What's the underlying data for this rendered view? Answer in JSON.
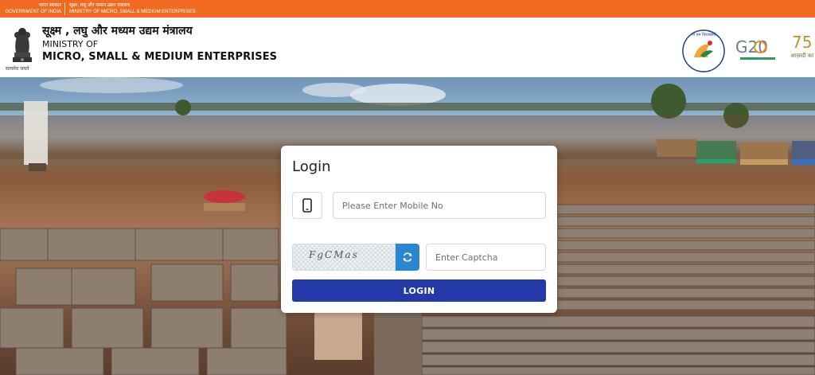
{
  "gov_strip": {
    "hindi_gov": "भारत सरकार",
    "english_gov": "GOVERNMENT OF INDIA",
    "hindi_ministry": "सूक्ष्म, लघु और मध्यम उद्यम मंत्रालय",
    "english_ministry": "MINISTRY OF MICRO, SMALL & MEDIUM ENTERPRISES"
  },
  "header": {
    "emblem_caption": "सत्यमेव जयते",
    "ministry_hindi": "सूक्ष्म , लघु और मध्यम उद्यम मंत्रालय",
    "ministry_of": "MINISTRY OF",
    "ministry_english": "MICRO, SMALL & MEDIUM ENTERPRISES",
    "logo_pm_text": "पी एम विश्वकर्मा",
    "logo_g20_text": "G20",
    "logo_azadi_text": "आज़ादी का अमृत म"
  },
  "login": {
    "title": "Login",
    "mobile_placeholder": "Please Enter Mobile No",
    "captcha_text": "FgCMas",
    "captcha_placeholder": "Enter Captcha",
    "login_label": "LOGIN"
  },
  "colors": {
    "gov_strip": "#f26a21",
    "login_button": "#2339a8",
    "refresh_button": "#2a86d1"
  },
  "icons": [
    "mobile-phone-icon",
    "refresh-icon",
    "national-emblem-icon"
  ]
}
